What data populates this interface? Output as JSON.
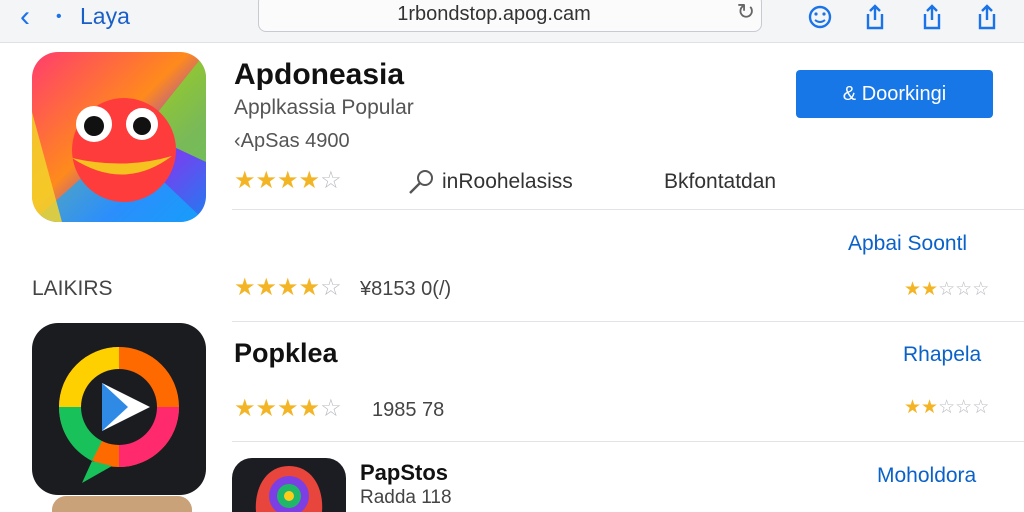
{
  "toolbar": {
    "back_label": "Laya",
    "url": "1rbondstop.apog.cam",
    "icons": [
      "back-chevron-icon",
      "reload-icon",
      "emoji-icon",
      "share-icon",
      "share-icon",
      "share-icon"
    ]
  },
  "featured": {
    "title": "Apdoneasia",
    "subtitle": "Applkassia ‌Popular",
    "meta": "‹ApSas 4900",
    "rating_stars": 4,
    "tag_label": "inRoohelasiss",
    "category": "Bkfontatdan",
    "button_label": "& Doorkingi",
    "link": "Apbai Soontl"
  },
  "section": {
    "heading": "LAIKIRS"
  },
  "list": [
    {
      "title": "",
      "rating_stars": 4,
      "meta": "¥8153 0(/)",
      "right_stars": 2,
      "link": ""
    },
    {
      "title": "Popklea",
      "rating_stars": 4,
      "meta": "1985 78",
      "right_stars": 2,
      "link": "Rhapela"
    },
    {
      "title": "PapStos",
      "subtitle": "Radda 118",
      "link": "Moholdora"
    }
  ],
  "colors": {
    "accent": "#1877e6",
    "link": "#0a62c9",
    "star": "#f3b526"
  }
}
